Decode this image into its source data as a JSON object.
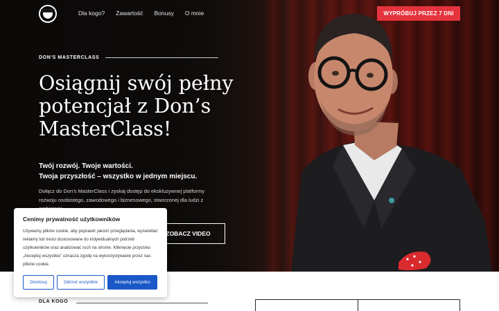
{
  "header": {
    "logo_icon": "don-logo-icon",
    "nav": [
      "Dla kogo?",
      "Zawartość",
      "Bonusy",
      "O mnie"
    ],
    "cta_label": "WYPRÓBUJ PRZEZ 7 DNI"
  },
  "hero": {
    "eyebrow": "DON'S MASTERCLASS",
    "headline_lines": [
      "Osiągnij swój pełny",
      "potencjał z Don’s",
      "MasterClass!"
    ],
    "subheading_line1": "Twój rozwój. Twoje wartości.",
    "subheading_line2": "Twoja przyszłość – wszystko w jednym miejscu.",
    "description": "Dołącz do Don’s MasterClass i zyskaj dostęp do ekskluzywnej platformy rozwoju osobistego, zawodowego i biznesowego, stworzonej dla ludzi z ambicjami",
    "video_button": "ZOBACZ VIDEO"
  },
  "section": {
    "label": "DLA KOGO"
  },
  "cookie": {
    "title": "Cenimy prywatność użytkowników",
    "text": "Używamy plików cookie, aby poprawić jakość przeglądania, wyświetlać reklamy lub treści dostosowane do indywidualnych potrzeb użytkowników oraz analizować ruch na stronie. Kliknięcie przycisku „Akceptuj wszystkie” oznacza zgodę na wykorzystywanie przez nas plików cookie.",
    "customize": "Dostosuj",
    "reject": "Odrzuć wszystkie",
    "accept": "Akceptuj wszystko"
  },
  "colors": {
    "cta_red": "#e5343d",
    "cookie_blue": "#1a58c7"
  }
}
